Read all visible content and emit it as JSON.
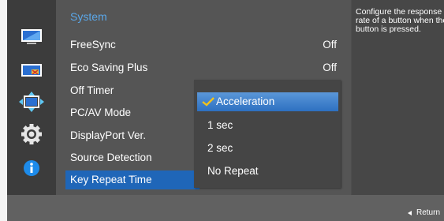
{
  "sidebar": {
    "icons": [
      {
        "name": "picture-icon"
      },
      {
        "name": "color-icon"
      },
      {
        "name": "size-position-icon"
      },
      {
        "name": "system-gear-icon"
      },
      {
        "name": "information-icon"
      }
    ]
  },
  "menu": {
    "title": "System",
    "items": [
      {
        "label": "FreeSync",
        "value": "Off"
      },
      {
        "label": "Eco Saving Plus",
        "value": "Off"
      },
      {
        "label": "Off Timer",
        "value": ""
      },
      {
        "label": "PC/AV Mode",
        "value": ""
      },
      {
        "label": "DisplayPort Ver.",
        "value": ""
      },
      {
        "label": "Source Detection",
        "value": ""
      },
      {
        "label": "Key Repeat Time",
        "value": ""
      }
    ],
    "selected_index": 6
  },
  "submenu": {
    "options": [
      "Acceleration",
      "1 sec",
      "2 sec",
      "No Repeat"
    ],
    "selected": "Acceleration"
  },
  "info": {
    "description": "Configure the response rate of a button when the button is pressed."
  },
  "footer": {
    "return_label": "Return"
  },
  "colors": {
    "title_blue": "#5aa7e9",
    "highlight_blue": "#1f66b8",
    "check_yellow": "#f2c21b"
  }
}
